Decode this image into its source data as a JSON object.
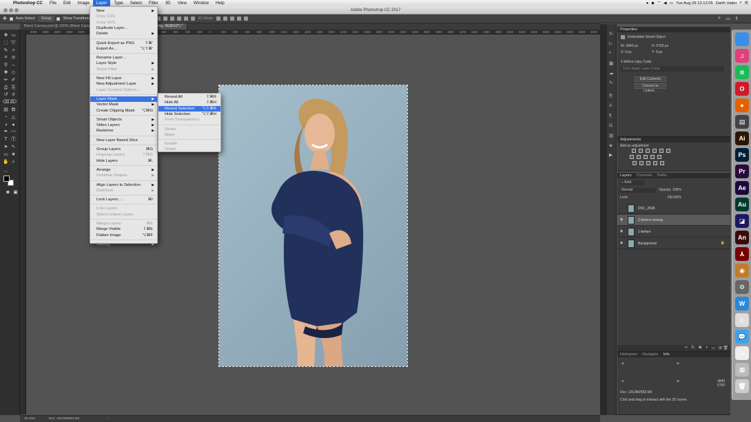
{
  "menubar": {
    "app_name": "Photoshop CC",
    "items": [
      "File",
      "Edit",
      "Image",
      "Layer",
      "Type",
      "Select",
      "Filter",
      "3D",
      "View",
      "Window",
      "Help"
    ],
    "clock": "Tue Aug 29  13:12:05",
    "user": "Darth Vader"
  },
  "window": {
    "title": "Adobe Photoshop CC 2017"
  },
  "options_bar": {
    "auto_select_label": "Auto-Select:",
    "auto_select_value": "Group",
    "show_transform_label": "Show Transform Controls",
    "mode_3d_label": "3D Mode:"
  },
  "tabs": [
    {
      "label": "Blank Canvas.psd @ 100% (Blank Canvas…",
      "active": false
    },
    {
      "label": "…3% (2-before-cloning, RGB/16*) *",
      "active": true
    }
  ],
  "ruler_ticks": [
    "3000",
    "2800",
    "2600",
    "2400",
    "2200",
    "2000",
    "1800",
    "1600",
    "1400",
    "1200",
    "1000",
    "800",
    "600",
    "400",
    "200",
    "0",
    "200",
    "400",
    "600",
    "800",
    "1000",
    "1200",
    "1400",
    "1600",
    "1800",
    "2000",
    "2200",
    "2400",
    "2600",
    "2800",
    "3000",
    "3200",
    "3400",
    "3600",
    "3800",
    "4000",
    "4200",
    "4400",
    "4600",
    "4800",
    "5000",
    "5200",
    "5400",
    "5600",
    "5800",
    "6000",
    "6200",
    "6400",
    "6600",
    "6800"
  ],
  "status": {
    "zoom": "33.33%",
    "doc": "Doc: 126.8M/583.6M"
  },
  "layer_menu": {
    "items": [
      {
        "label": "New",
        "arrow": true
      },
      {
        "label": "Copy CSS",
        "disabled": true
      },
      {
        "label": "Copy SVG",
        "disabled": true
      },
      {
        "label": "Duplicate Layer…"
      },
      {
        "label": "Delete",
        "arrow": true
      },
      {
        "sep": true
      },
      {
        "label": "Quick Export as PNG",
        "shortcut": "⇧⌘'"
      },
      {
        "label": "Export As…",
        "shortcut": "⌥⇧⌘'"
      },
      {
        "sep": true
      },
      {
        "label": "Rename Layer…"
      },
      {
        "label": "Layer Style",
        "arrow": true
      },
      {
        "label": "Smart Filter",
        "arrow": true,
        "disabled": true
      },
      {
        "sep": true
      },
      {
        "label": "New Fill Layer",
        "arrow": true
      },
      {
        "label": "New Adjustment Layer",
        "arrow": true
      },
      {
        "label": "Layer Content Options…",
        "disabled": true
      },
      {
        "sep": true
      },
      {
        "label": "Layer Mask",
        "arrow": true,
        "highlight": true
      },
      {
        "label": "Vector Mask",
        "arrow": true
      },
      {
        "label": "Create Clipping Mask",
        "shortcut": "⌥⌘G"
      },
      {
        "sep": true
      },
      {
        "label": "Smart Objects",
        "arrow": true
      },
      {
        "label": "Video Layers",
        "arrow": true
      },
      {
        "label": "Rasterize",
        "arrow": true
      },
      {
        "sep": true
      },
      {
        "label": "New Layer Based Slice"
      },
      {
        "sep": true
      },
      {
        "label": "Group Layers",
        "shortcut": "⌘G"
      },
      {
        "label": "Ungroup Layers",
        "shortcut": "⇧⌘G",
        "disabled": true
      },
      {
        "label": "Hide Layers",
        "shortcut": "⌘,"
      },
      {
        "sep": true
      },
      {
        "label": "Arrange",
        "arrow": true
      },
      {
        "label": "Combine Shapes",
        "arrow": true,
        "disabled": true
      },
      {
        "sep": true
      },
      {
        "label": "Align Layers to Selection",
        "arrow": true
      },
      {
        "label": "Distribute",
        "arrow": true,
        "disabled": true
      },
      {
        "sep": true
      },
      {
        "label": "Lock Layers…",
        "shortcut": "⌘/"
      },
      {
        "sep": true
      },
      {
        "label": "Link Layers",
        "disabled": true
      },
      {
        "label": "Select Linked Layers",
        "disabled": true
      },
      {
        "sep": true
      },
      {
        "label": "Merge Layers",
        "shortcut": "⌘E",
        "disabled": true
      },
      {
        "label": "Merge Visible",
        "shortcut": "⇧⌘E"
      },
      {
        "label": "Flatten Image",
        "shortcut": "⌥⌘F"
      },
      {
        "sep": true
      },
      {
        "label": "Matting",
        "arrow": true,
        "disabled": true
      }
    ]
  },
  "mask_submenu": {
    "items": [
      {
        "label": "Reveal All",
        "shortcut": "⇧⌘R"
      },
      {
        "label": "Hide All",
        "shortcut": "⇧⌘H"
      },
      {
        "label": "Reveal Selection",
        "shortcut": "⌥⇧⌘R",
        "highlight": true
      },
      {
        "label": "Hide Selection",
        "shortcut": "⌥⇧⌘H"
      },
      {
        "label": "From Transparency",
        "disabled": true
      },
      {
        "sep": true
      },
      {
        "label": "Delete",
        "disabled": true
      },
      {
        "label": "Apply",
        "disabled": true
      },
      {
        "sep": true
      },
      {
        "label": "Enable",
        "disabled": true
      },
      {
        "label": "Unlink",
        "disabled": true
      }
    ]
  },
  "properties": {
    "title": "Properties",
    "object_type": "Embedded Smart Object",
    "w": "W: 3840 px",
    "h": "H: 5760 px",
    "x": "X: 0 px",
    "y": "Y: 0 px",
    "filename": "1-before copy 2.psb",
    "layer_comp_placeholder": "Don't Apply Layer Comp",
    "edit_contents": "Edit Contents",
    "convert_linked": "Convert to Linked…"
  },
  "adjustments": {
    "title": "Adjustments",
    "subtitle": "Add an adjustment"
  },
  "layers_panel": {
    "tabs": [
      "Layers",
      "Channels",
      "Paths"
    ],
    "kind": "Kind",
    "blend_mode": "Normal",
    "opacity_label": "Opacity:",
    "opacity": "100%",
    "lock_label": "Lock:",
    "fill_label": "Fill:",
    "fill": "100%",
    "layers": [
      {
        "name": "DSC_2528",
        "visible": false,
        "selected": false
      },
      {
        "name": "2-before-cloning",
        "visible": true,
        "selected": true
      },
      {
        "name": "1-before",
        "visible": true,
        "selected": false
      },
      {
        "name": "Background",
        "visible": true,
        "selected": false,
        "locked": true
      }
    ]
  },
  "info_panel": {
    "tabs": [
      "Histogram",
      "Navigator",
      "Info"
    ],
    "doc": "Doc: 126.8M/583.6M",
    "hint": "Click and drag to interact with the 3D scene.",
    "w_val": "3840",
    "h_val": "5760"
  },
  "dock_apps": [
    {
      "name": "finder-icon",
      "label": "",
      "color": "#3a8ee6"
    },
    {
      "name": "itunes-icon",
      "label": "♫",
      "color": "#e0407a"
    },
    {
      "name": "spotify-icon",
      "label": "≋",
      "color": "#1db954"
    },
    {
      "name": "opera-icon",
      "label": "O",
      "color": "#cc1b2a"
    },
    {
      "name": "firefox-icon",
      "label": "●",
      "color": "#e66000"
    },
    {
      "name": "clapper-icon",
      "label": "▤",
      "color": "#444"
    },
    {
      "name": "illustrator-icon",
      "label": "Ai",
      "color": "#2b1700"
    },
    {
      "name": "photoshop-icon",
      "label": "Ps",
      "color": "#001e36"
    },
    {
      "name": "premiere-icon",
      "label": "Pr",
      "color": "#2a0a3a"
    },
    {
      "name": "aftereffects-icon",
      "label": "Ae",
      "color": "#1a0a3a"
    },
    {
      "name": "audition-icon",
      "label": "Au",
      "color": "#00382c"
    },
    {
      "name": "bridge-icon",
      "label": "◪",
      "color": "#1a1a60"
    },
    {
      "name": "animate-icon",
      "label": "An",
      "color": "#3a0a0a"
    },
    {
      "name": "acrobat-icon",
      "label": "⅄",
      "color": "#7a0000"
    },
    {
      "name": "chrome-preview-icon",
      "label": "◉",
      "color": "#c27b2a"
    },
    {
      "name": "system-prefs-icon",
      "label": "⚙",
      "color": "#666"
    },
    {
      "name": "wunderlist-icon",
      "label": "W",
      "color": "#2b88d9"
    },
    {
      "name": "chrome-icon",
      "label": "◎",
      "color": "#ddd"
    },
    {
      "name": "messages-icon",
      "label": "💬",
      "color": "#3aa3f0"
    },
    {
      "name": "paper-icon",
      "label": "▱",
      "color": "#eee"
    },
    {
      "name": "photos-icon",
      "label": "▦",
      "color": "#bbb"
    },
    {
      "name": "trash-icon",
      "label": "🗑",
      "color": "#ccc"
    }
  ]
}
